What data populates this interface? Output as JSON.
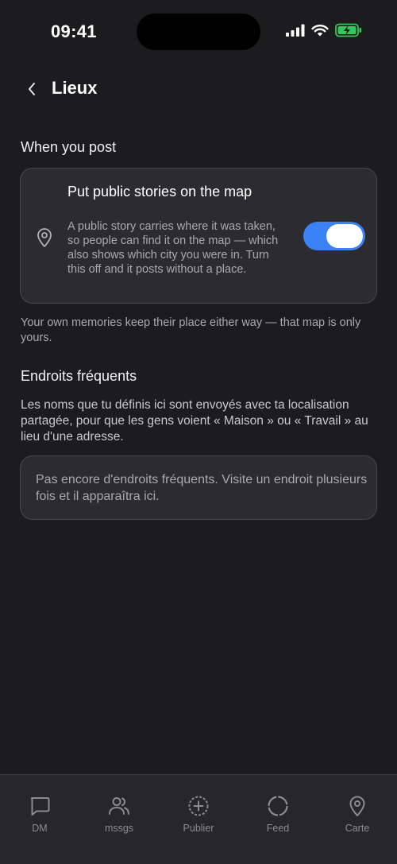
{
  "status_bar": {
    "time": "09:41",
    "icons": [
      "cellular-signal-icon",
      "wifi-icon",
      "battery-charging-icon"
    ]
  },
  "nav": {
    "back_icon": "chevron-left-icon",
    "title": "Lieux"
  },
  "when_you_post": {
    "heading": "When you post",
    "toggle": {
      "icon": "map-pin-icon",
      "title": "Put public stories on the map",
      "description": "A public story carries where it was taken, so people can find it on the map — which also shows which city you were in. Turn this off and it posts without a place.",
      "enabled": true
    },
    "footnote": "Your own memories keep their place either way — that map is only yours."
  },
  "frequent_places": {
    "heading": "Endroits fréquents",
    "description": "Les noms que tu définis ici sont envoyés avec ta localisation partagée, pour que les gens voient « Maison » ou « Travail » au lieu d'une adresse.",
    "empty_state": "Pas encore d'endroits fréquents. Visite un endroit plusieurs fois et il apparaîtra ici."
  },
  "tabbar": {
    "items": [
      {
        "label": "DM",
        "icon": "chat-bubble-icon"
      },
      {
        "label": "mssgs",
        "icon": "people-icon"
      },
      {
        "label": "Publier",
        "icon": "plus-circle-icon"
      },
      {
        "label": "Feed",
        "icon": "circle-icon"
      },
      {
        "label": "Carte",
        "icon": "map-pin-icon"
      }
    ]
  },
  "colors": {
    "background": "#1c1c1f",
    "card": "#2c2c30",
    "accent_toggle": "#3b82f6",
    "battery": "#34c759"
  }
}
